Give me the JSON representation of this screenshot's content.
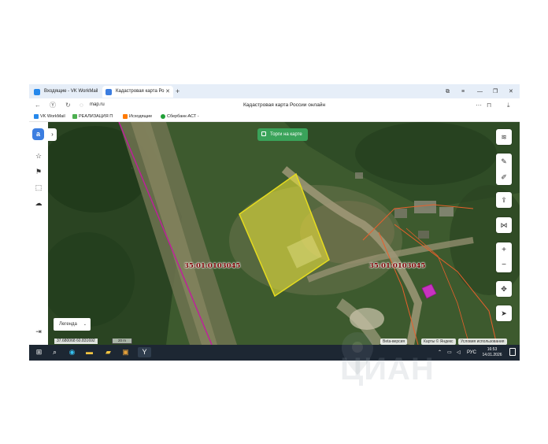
{
  "browser": {
    "tabs": [
      {
        "label": "Входящие - VK WorkMail",
        "icon_color": "#2688eb"
      },
      {
        "label": "Кадастровая карта Ро",
        "icon_color": "#3b7de0"
      }
    ],
    "new_tab_icon": "plus-icon",
    "url": "map.ru",
    "page_title": "Кадастровая карта России онлайн",
    "bookmarks": [
      {
        "label": "VK WorkMail",
        "icon_color": "#2688eb"
      },
      {
        "label": "РЕАЛИЗАЦИЯ П",
        "icon_color": "#4caf50"
      },
      {
        "label": "Исходящие",
        "icon_color": "#ff7a00"
      },
      {
        "label": "Сбербанк-АСТ -",
        "icon_color": "#21a038"
      }
    ]
  },
  "map": {
    "torgi_button": "Торги на карте",
    "legend_button": "Легенда",
    "coordinates": "37.680068  60.831692",
    "scale": "20 m",
    "beta_label": "Beta-версия",
    "maps_attribution": "Карты © Яндекс",
    "terms_link": "Условия использования",
    "cadastral_labels": [
      "35:01:0103045",
      "35:01:0103045"
    ],
    "colors": {
      "parcel_fill": "#f2ea3b",
      "parcel_stroke": "#e6dc1e",
      "boundary_line": "#c21b9e",
      "neighbor_boundary": "#e8602c",
      "building": "#d62fd0",
      "torgi_green": "#3aa35a"
    }
  },
  "taskbar": {
    "language": "РУС",
    "time": "16:53",
    "date": "14.01.2026"
  },
  "watermark": "ЦИАН"
}
